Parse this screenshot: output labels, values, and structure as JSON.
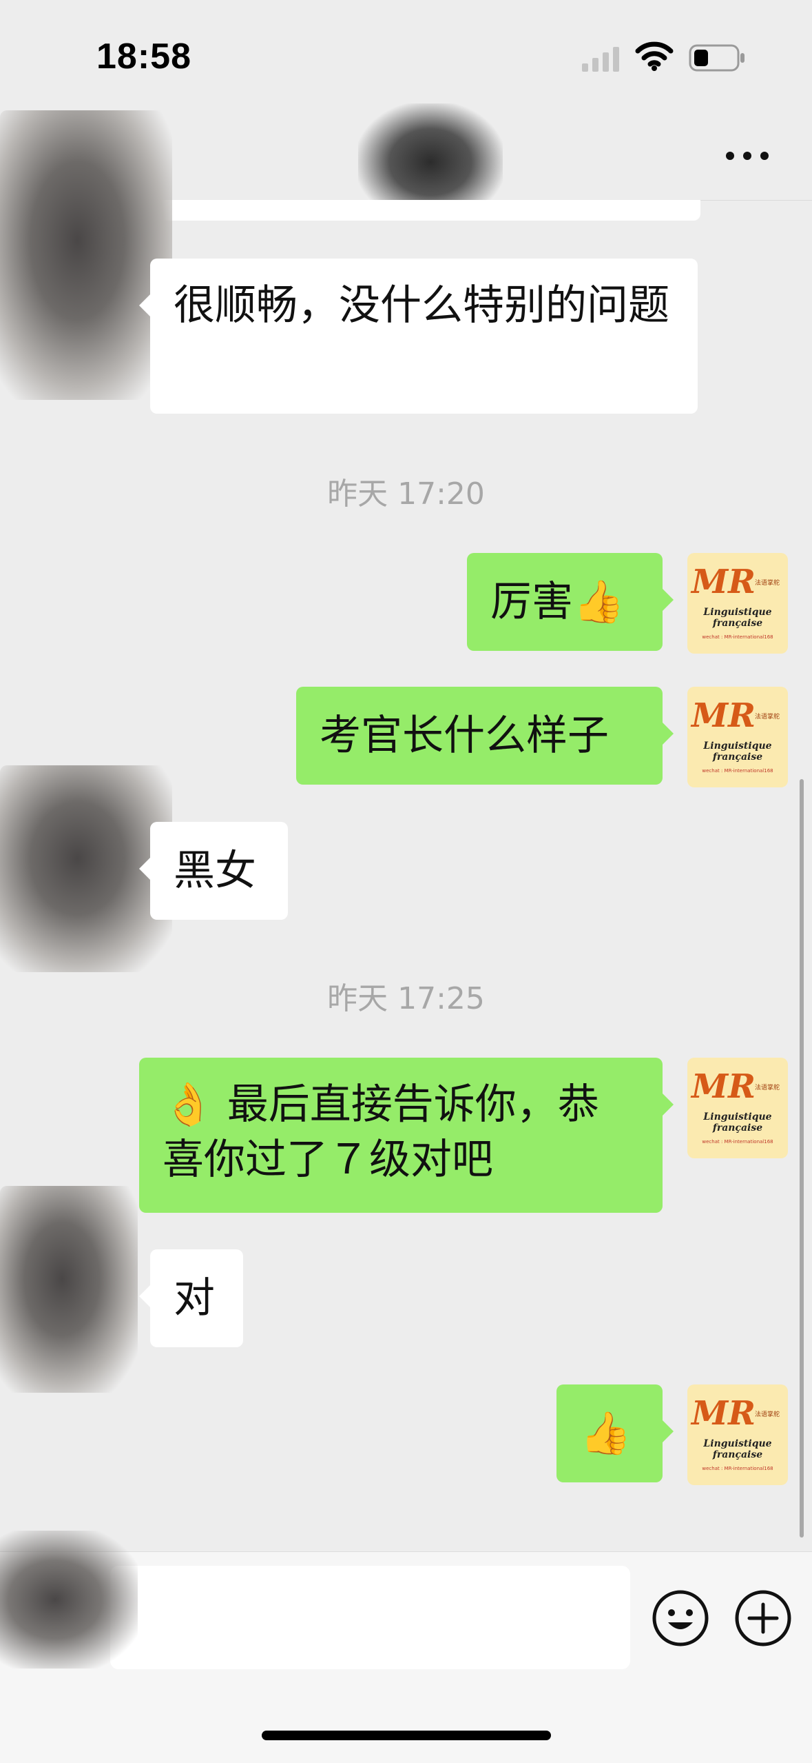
{
  "status_bar": {
    "time": "18:58"
  },
  "nav": {
    "more_icon": "more-dots-icon"
  },
  "messages": [
    {
      "side": "in",
      "text": "很顺畅，没什么特别的问题"
    },
    {
      "type": "time",
      "text": "昨天 17:20"
    },
    {
      "side": "out",
      "text": "厉害👍"
    },
    {
      "side": "out",
      "text": "考官长什么样子"
    },
    {
      "side": "in",
      "text": "黑女"
    },
    {
      "type": "time",
      "text": "昨天 17:25"
    },
    {
      "side": "out",
      "text": "👌 最后直接告诉你，恭喜你过了７级对吧"
    },
    {
      "side": "in",
      "text": "对"
    },
    {
      "side": "out",
      "text": "👍"
    }
  ],
  "avatar_out": {
    "logo": "MR",
    "logo_sub": "法语掌舵",
    "tagline": "Linguistique française",
    "wechat": "wechat : MR-international168"
  },
  "input_bar": {
    "emoji_icon": "smiley-icon",
    "plus_icon": "plus-circle-icon"
  }
}
